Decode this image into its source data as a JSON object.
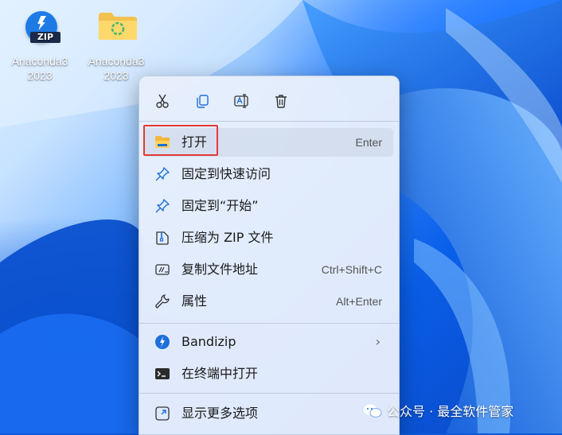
{
  "desktop": {
    "icons": [
      {
        "label": "Anaconda3",
        "label2": "2023",
        "icon": "zip-archive-icon",
        "badge_text": "ZIP"
      },
      {
        "label": "Anaconda3",
        "label2": "2023",
        "icon": "folder-icon"
      }
    ]
  },
  "context_menu": {
    "toolbar": [
      {
        "icon": "cut-icon"
      },
      {
        "icon": "copy-icon"
      },
      {
        "icon": "rename-icon"
      },
      {
        "icon": "delete-icon"
      }
    ],
    "items": [
      {
        "label": "打开",
        "shortcut": "Enter",
        "icon": "folder-open-icon",
        "highlighted": true
      },
      {
        "label": "固定到快速访问",
        "shortcut": "",
        "icon": "pin-icon"
      },
      {
        "label": "固定到“开始”",
        "shortcut": "",
        "icon": "pin-icon"
      },
      {
        "label": "压缩为 ZIP 文件",
        "shortcut": "",
        "icon": "zip-file-icon"
      },
      {
        "label": "复制文件地址",
        "shortcut": "Ctrl+Shift+C",
        "icon": "copy-path-icon"
      },
      {
        "label": "属性",
        "shortcut": "Alt+Enter",
        "icon": "wrench-icon"
      },
      {
        "label": "Bandizip",
        "shortcut": "",
        "icon": "bandizip-icon",
        "has_submenu": true
      },
      {
        "label": "在终端中打开",
        "shortcut": "",
        "icon": "terminal-icon"
      },
      {
        "label": "显示更多选项",
        "shortcut": "",
        "icon": "more-options-icon"
      }
    ]
  },
  "watermark": {
    "text": "公众号 · 最全软件管家"
  },
  "colors": {
    "accent": "#1e7be6",
    "highlight_border": "#e53935",
    "menu_bg": "#e8effc"
  }
}
